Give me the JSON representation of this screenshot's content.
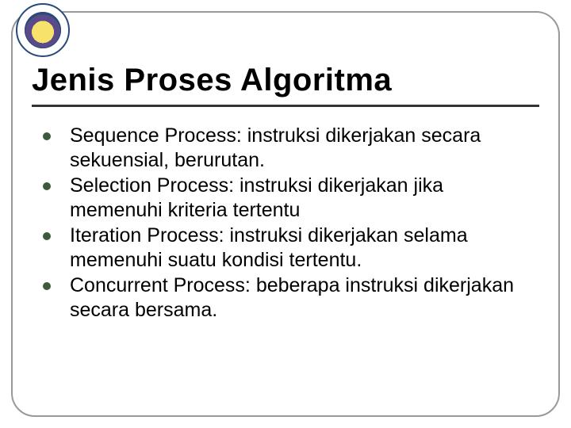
{
  "title": "Jenis Proses Algoritma",
  "bullets": [
    "Sequence Process: instruksi dikerjakan secara sekuensial, berurutan.",
    "Selection Process: instruksi dikerjakan jika memenuhi kriteria tertentu",
    "Iteration Process: instruksi dikerjakan selama memenuhi suatu kondisi tertentu.",
    "Concurrent Process: beberapa instruksi dikerjakan secara bersama."
  ]
}
